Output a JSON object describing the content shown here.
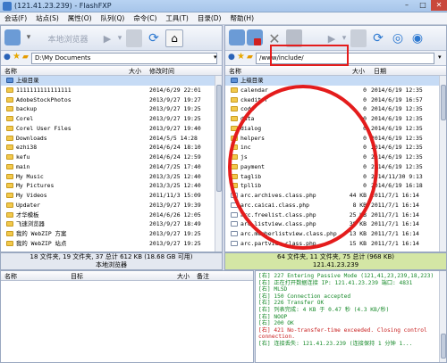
{
  "window": {
    "title": "(121.41.23.239) - FlashFXP"
  },
  "menu": [
    "会话(F)",
    "站点(S)",
    "属性(O)",
    "队列(Q)",
    "命令(C)",
    "工具(T)",
    "目录(D)",
    "帮助(H)"
  ],
  "left": {
    "label": "本地浏览器",
    "path": "D:\\My Documents",
    "cols": {
      "name": "名称",
      "size": "大小",
      "date": "修改时间"
    },
    "rows": [
      {
        "name": "上级目录",
        "size": "",
        "date": "",
        "type": "up"
      },
      {
        "name": "1111111111111111",
        "size": "",
        "date": "2014/6/29 22:01",
        "type": "folder"
      },
      {
        "name": "AdobeStockPhotos",
        "size": "",
        "date": "2013/9/27 19:27",
        "type": "folder"
      },
      {
        "name": "backup",
        "size": "",
        "date": "2013/9/27 19:25",
        "type": "folder"
      },
      {
        "name": "Corel",
        "size": "",
        "date": "2013/9/27 19:25",
        "type": "folder"
      },
      {
        "name": "Corel User Files",
        "size": "",
        "date": "2013/9/27 19:40",
        "type": "folder"
      },
      {
        "name": "Downloads",
        "size": "",
        "date": "2014/5/5 14:28",
        "type": "folder"
      },
      {
        "name": "ezhi38",
        "size": "",
        "date": "2014/6/24 18:10",
        "type": "folder"
      },
      {
        "name": "kefu",
        "size": "",
        "date": "2014/6/24 12:59",
        "type": "folder"
      },
      {
        "name": "main",
        "size": "",
        "date": "2014/7/25 17:40",
        "type": "folder"
      },
      {
        "name": "My Music",
        "size": "",
        "date": "2013/3/25 12:40",
        "type": "folder"
      },
      {
        "name": "My Pictures",
        "size": "",
        "date": "2013/3/25 12:40",
        "type": "folder"
      },
      {
        "name": "My Videos",
        "size": "",
        "date": "2011/11/3 15:09",
        "type": "folder"
      },
      {
        "name": "Updater",
        "size": "",
        "date": "2013/9/27 19:39",
        "type": "folder"
      },
      {
        "name": "才华模板",
        "size": "",
        "date": "2014/6/26 12:05",
        "type": "folder"
      },
      {
        "name": "飞速浏览器",
        "size": "",
        "date": "2013/9/27 18:49",
        "type": "folder"
      },
      {
        "name": "我的 WebZIP 方案",
        "size": "",
        "date": "2013/9/27 19:25",
        "type": "folder"
      },
      {
        "name": "我的 WebZIP 站点",
        "size": "",
        "date": "2013/9/27 19:25",
        "type": "folder"
      }
    ],
    "status": "18 文件夹, 19 文件夹, 37 总计 612 KB (18.68 GB 可用)",
    "status2": "本地浏览器"
  },
  "right": {
    "path": "/www/include/",
    "cols": {
      "name": "名称",
      "size": "大小",
      "date": "日期"
    },
    "rows": [
      {
        "name": "上级目录",
        "size": "",
        "date": "",
        "type": "up"
      },
      {
        "name": "calendar",
        "size": "0",
        "date": "2014/6/19 12:35",
        "type": "folder"
      },
      {
        "name": "ckeditor",
        "size": "0",
        "date": "2014/6/19 16:57",
        "type": "folder"
      },
      {
        "name": "code",
        "size": "0",
        "date": "2014/6/19 12:35",
        "type": "folder"
      },
      {
        "name": "data",
        "size": "0",
        "date": "2014/6/19 12:35",
        "type": "folder"
      },
      {
        "name": "dialog",
        "size": "0",
        "date": "2014/6/19 12:35",
        "type": "folder"
      },
      {
        "name": "helpers",
        "size": "0",
        "date": "2014/6/19 12:35",
        "type": "folder"
      },
      {
        "name": "inc",
        "size": "0",
        "date": "2014/6/19 12:35",
        "type": "folder"
      },
      {
        "name": "js",
        "size": "0",
        "date": "2014/6/19 12:35",
        "type": "folder"
      },
      {
        "name": "payment",
        "size": "0",
        "date": "2014/6/19 12:35",
        "type": "folder"
      },
      {
        "name": "taglib",
        "size": "0",
        "date": "2014/11/30 9:13",
        "type": "folder"
      },
      {
        "name": "tpllib",
        "size": "0",
        "date": "2014/6/19 16:18",
        "type": "folder"
      },
      {
        "name": "arc.archives.class.php",
        "size": "44 KB",
        "date": "2011/7/1 16:14",
        "type": "file"
      },
      {
        "name": "arc.caicai.class.php",
        "size": "8 KB",
        "date": "2011/7/1 16:14",
        "type": "file"
      },
      {
        "name": "arc.freelist.class.php",
        "size": "25 KB",
        "date": "2011/7/1 16:14",
        "type": "file"
      },
      {
        "name": "arc.listview.class.php",
        "size": "38 KB",
        "date": "2011/7/1 16:14",
        "type": "file"
      },
      {
        "name": "arc.memberlistview.class.php",
        "size": "13 KB",
        "date": "2011/7/1 16:14",
        "type": "file"
      },
      {
        "name": "arc.partview.class.php",
        "size": "15 KB",
        "date": "2011/7/1 16:14",
        "type": "file"
      }
    ],
    "status": "64 文件夹, 11 文件夹, 75 总计 (968 KB)",
    "status2": "121.41.23.239"
  },
  "queue": {
    "cols": {
      "name": "名称",
      "target": "目标",
      "size": "大小",
      "note": "备注"
    }
  },
  "log": [
    {
      "text": "[右] 227 Entering Passive Mode (121,41,23,239,18,223)",
      "color": "green"
    },
    {
      "text": "[右] 正在打开数据连接 IP: 121.41.23.239 端口: 4831",
      "color": "green"
    },
    {
      "text": "[右] MLSD",
      "color": "green"
    },
    {
      "text": "[右] 150 Connection accepted",
      "color": "green"
    },
    {
      "text": "[右] 226 Transfer OK",
      "color": "green"
    },
    {
      "text": "[右] 列表完成: 4 KB 于 0.47 秒 (4.3 KB/秒)",
      "color": "green"
    },
    {
      "text": "[右] NOOP",
      "color": "green"
    },
    {
      "text": "[右] 200 OK",
      "color": "green"
    },
    {
      "text": "[右] 421 No-transfer-time exceeded. Closing control",
      "color": "red"
    },
    {
      "text": "connection.",
      "color": "red"
    },
    {
      "text": "[右] 连接丢失: 121.41.23.239 (连接保持 1 分钟 1...",
      "color": "green"
    }
  ],
  "colors": {
    "accent_red": "#e41c1c",
    "remote_status_bg": "#d4e6a5"
  }
}
